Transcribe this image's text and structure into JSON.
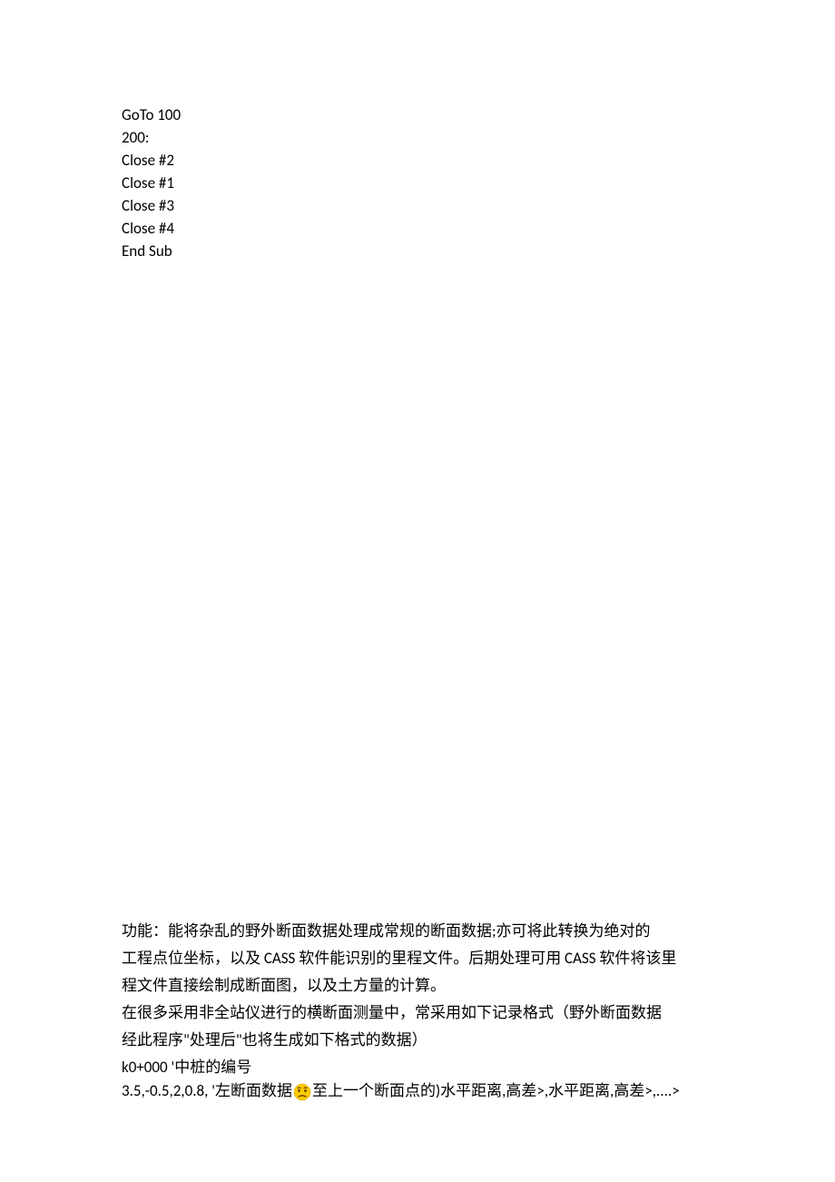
{
  "code": {
    "line1": "GoTo 100",
    "line2": "200:",
    "line3": "Close #2",
    "line4": "Close #1",
    "line5": "Close #3",
    "line6": "Close #4",
    "line7": "End Sub"
  },
  "paragraph": {
    "line1": "功能：能将杂乱的野外断面数据处理成常规的断面数据;亦可将此转换为绝对的",
    "line2": "工程点位坐标，以及 CASS 软件能识别的里程文件。后期处理可用 CASS 软件将该里",
    "line3": "程文件直接绘制成断面图，以及土方量的计算。",
    "line4": "在很多采用非全站仪进行的横断面测量中，常采用如下记录格式（野外断面数据",
    "line5": "经此程序\"处理后\"也将生成如下格式的数据）",
    "line6": "k0+000           '中桩的编号"
  },
  "final": {
    "prefix": "3.5,-0.5,2,0.8,    '左断面数据",
    "suffix": "至上一个断面点的)水平距离,高差>,水平距离,高差>,....>"
  }
}
